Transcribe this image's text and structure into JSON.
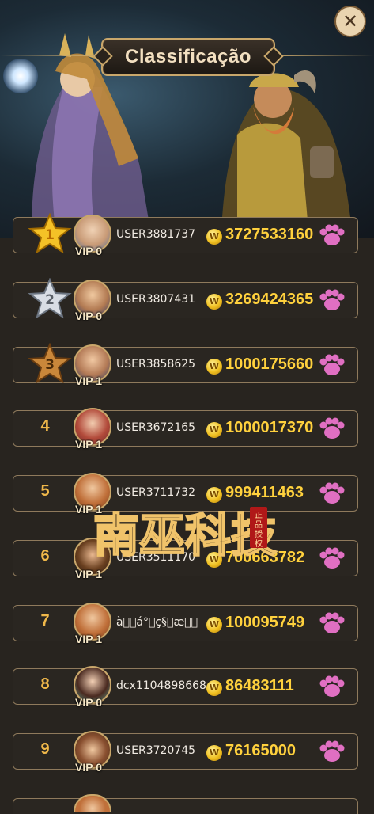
{
  "header": {
    "title": "Classificação",
    "close_icon": "close-icon"
  },
  "rankings": [
    {
      "rank": "1",
      "username": "USER3881737",
      "vip": "VIP 0",
      "amount": "3727533160",
      "badge": "gold-star"
    },
    {
      "rank": "2",
      "username": "USER3807431",
      "vip": "VIP 0",
      "amount": "3269424365",
      "badge": "silver-star"
    },
    {
      "rank": "3",
      "username": "USER3858625",
      "vip": "VIP 1",
      "amount": "1000175660",
      "badge": "bronze-star"
    },
    {
      "rank": "4",
      "username": "USER3672165",
      "vip": "VIP 1",
      "amount": "1000017370",
      "badge": ""
    },
    {
      "rank": "5",
      "username": "USER3711732",
      "vip": "VIP 1",
      "amount": "999411463",
      "badge": ""
    },
    {
      "rank": "6",
      "username": "USER3511170",
      "vip": "VIP 1",
      "amount": "700663782",
      "badge": ""
    },
    {
      "rank": "7",
      "username": "à\u0000\u0000á°\u0000ç§\u0000æ\u0000\u0000",
      "vip": "VIP 1",
      "amount": "100095749",
      "badge": ""
    },
    {
      "rank": "8",
      "username": "dcx1104898668",
      "vip": "VIP 0",
      "amount": "86483111",
      "badge": ""
    },
    {
      "rank": "9",
      "username": "USER3720745",
      "vip": "VIP 0",
      "amount": "76165000",
      "badge": ""
    }
  ],
  "coin_icon": "W",
  "colors": {
    "accent_gold": "#ffd13d",
    "rank_orange": "#f0b84a",
    "border": "#8f7a5c",
    "paw_pink": "#e06fc2"
  },
  "watermark": {
    "text": "南巫科技",
    "seal": "正品授权"
  }
}
